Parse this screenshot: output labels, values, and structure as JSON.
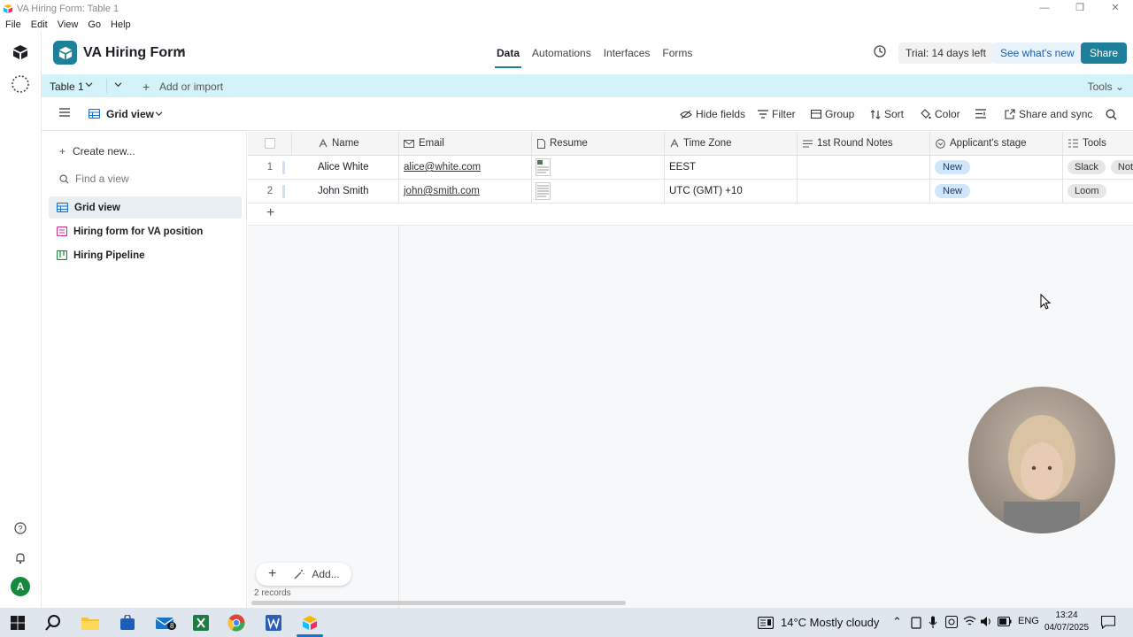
{
  "window": {
    "title": "VA Hiring Form: Table 1",
    "controls": [
      "—",
      "❐",
      "✕"
    ]
  },
  "menubar": [
    "File",
    "Edit",
    "View",
    "Go",
    "Help"
  ],
  "rail": {
    "avatar_letter": "A"
  },
  "header": {
    "base_name": "VA Hiring Form",
    "tabs": [
      "Data",
      "Automations",
      "Interfaces",
      "Forms"
    ],
    "trial": "Trial: 14 days left",
    "whats_new": "See what's new",
    "share": "Share"
  },
  "tablebar": {
    "table_name": "Table 1",
    "add_import": "Add or import",
    "tools": "Tools"
  },
  "viewbar": {
    "view_name": "Grid view",
    "tools": [
      "Hide fields",
      "Filter",
      "Group",
      "Sort",
      "Color",
      "Share and sync"
    ]
  },
  "sidebar": {
    "create": "Create new...",
    "find_placeholder": "Find a view",
    "views": [
      "Grid view",
      "Hiring form for VA position",
      "Hiring Pipeline"
    ]
  },
  "grid": {
    "columns": [
      "Name",
      "Email",
      "Resume",
      "Time Zone",
      "1st Round Notes",
      "Applicant's stage",
      "Tools"
    ],
    "rows": [
      {
        "num": "1",
        "name": "Alice White",
        "email": "alice@white.com",
        "timezone": "EEST",
        "notes": "",
        "stage": "New",
        "tools": [
          "Slack",
          "Notio"
        ]
      },
      {
        "num": "2",
        "name": "John Smith",
        "email": "john@smith.com",
        "timezone": "UTC (GMT) +10",
        "notes": "",
        "stage": "New",
        "tools": [
          "Loom"
        ]
      }
    ],
    "add_label": "Add...",
    "records": "2 records"
  },
  "taskbar": {
    "weather": "14°C  Mostly cloudy",
    "lang": "ENG",
    "time": "13:24",
    "date": "04/07/2025",
    "mail_badge": "8"
  },
  "colors": {
    "accent": "#1d7f9a",
    "tablebar": "#d3f3f8",
    "pill": "#cfe6fb"
  }
}
